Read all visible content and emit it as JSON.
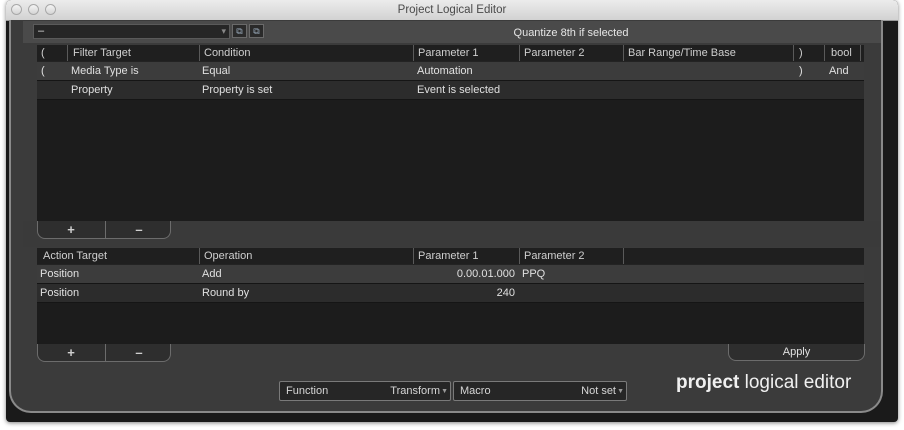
{
  "window": {
    "title": "Project Logical Editor"
  },
  "toolbar": {
    "preset_value": "–",
    "quantize_text": "Quantize 8th if selected"
  },
  "filter_table": {
    "headers": [
      "(",
      "Filter Target",
      "Condition",
      "Parameter 1",
      "Parameter 2",
      "Bar Range/Time Base",
      ")",
      "bool"
    ],
    "rows": [
      {
        "open": "(",
        "target": "Media Type is",
        "condition": "Equal",
        "param1": "Automation",
        "param2": "",
        "range": "",
        "close": ")",
        "bool": "And"
      },
      {
        "open": "",
        "target": "Property",
        "condition": "Property is set",
        "param1": "Event is selected",
        "param2": "",
        "range": "",
        "close": "",
        "bool": ""
      }
    ]
  },
  "action_table": {
    "headers": [
      "Action Target",
      "Operation",
      "Parameter 1",
      "Parameter 2"
    ],
    "rows": [
      {
        "target": "Position",
        "operation": "Add",
        "param1": "0.00.01.000",
        "param2": "PPQ"
      },
      {
        "target": "Position",
        "operation": "Round by",
        "param1": "240",
        "param2": ""
      }
    ]
  },
  "buttons": {
    "add": "+",
    "remove": "–",
    "apply": "Apply"
  },
  "function_select": {
    "label": "Function",
    "value": "Transform"
  },
  "macro_select": {
    "label": "Macro",
    "value": "Not set"
  },
  "brand": {
    "bold": "project",
    "rest": " logical editor"
  },
  "icons": {
    "copy": "copy-icon",
    "paste": "paste-icon"
  }
}
